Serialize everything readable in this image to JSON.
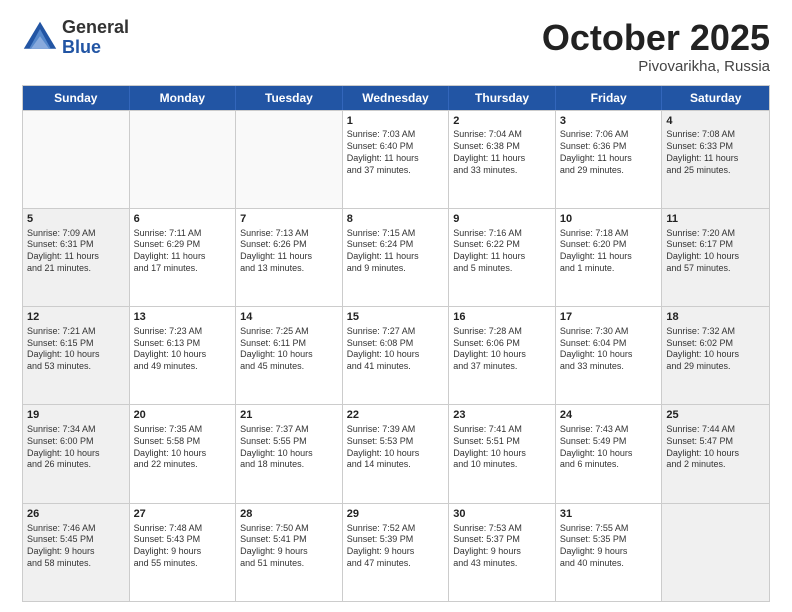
{
  "header": {
    "logo": {
      "general": "General",
      "blue": "Blue"
    },
    "title": "October 2025",
    "subtitle": "Pivovarikha, Russia"
  },
  "calendar": {
    "days": [
      "Sunday",
      "Monday",
      "Tuesday",
      "Wednesday",
      "Thursday",
      "Friday",
      "Saturday"
    ],
    "rows": [
      [
        {
          "day": "",
          "info": "",
          "empty": true
        },
        {
          "day": "",
          "info": "",
          "empty": true
        },
        {
          "day": "",
          "info": "",
          "empty": true
        },
        {
          "day": "1",
          "info": "Sunrise: 7:03 AM\nSunset: 6:40 PM\nDaylight: 11 hours\nand 37 minutes."
        },
        {
          "day": "2",
          "info": "Sunrise: 7:04 AM\nSunset: 6:38 PM\nDaylight: 11 hours\nand 33 minutes."
        },
        {
          "day": "3",
          "info": "Sunrise: 7:06 AM\nSunset: 6:36 PM\nDaylight: 11 hours\nand 29 minutes."
        },
        {
          "day": "4",
          "info": "Sunrise: 7:08 AM\nSunset: 6:33 PM\nDaylight: 11 hours\nand 25 minutes.",
          "shaded": true
        }
      ],
      [
        {
          "day": "5",
          "info": "Sunrise: 7:09 AM\nSunset: 6:31 PM\nDaylight: 11 hours\nand 21 minutes.",
          "shaded": true
        },
        {
          "day": "6",
          "info": "Sunrise: 7:11 AM\nSunset: 6:29 PM\nDaylight: 11 hours\nand 17 minutes."
        },
        {
          "day": "7",
          "info": "Sunrise: 7:13 AM\nSunset: 6:26 PM\nDaylight: 11 hours\nand 13 minutes."
        },
        {
          "day": "8",
          "info": "Sunrise: 7:15 AM\nSunset: 6:24 PM\nDaylight: 11 hours\nand 9 minutes."
        },
        {
          "day": "9",
          "info": "Sunrise: 7:16 AM\nSunset: 6:22 PM\nDaylight: 11 hours\nand 5 minutes."
        },
        {
          "day": "10",
          "info": "Sunrise: 7:18 AM\nSunset: 6:20 PM\nDaylight: 11 hours\nand 1 minute."
        },
        {
          "day": "11",
          "info": "Sunrise: 7:20 AM\nSunset: 6:17 PM\nDaylight: 10 hours\nand 57 minutes.",
          "shaded": true
        }
      ],
      [
        {
          "day": "12",
          "info": "Sunrise: 7:21 AM\nSunset: 6:15 PM\nDaylight: 10 hours\nand 53 minutes.",
          "shaded": true
        },
        {
          "day": "13",
          "info": "Sunrise: 7:23 AM\nSunset: 6:13 PM\nDaylight: 10 hours\nand 49 minutes."
        },
        {
          "day": "14",
          "info": "Sunrise: 7:25 AM\nSunset: 6:11 PM\nDaylight: 10 hours\nand 45 minutes."
        },
        {
          "day": "15",
          "info": "Sunrise: 7:27 AM\nSunset: 6:08 PM\nDaylight: 10 hours\nand 41 minutes."
        },
        {
          "day": "16",
          "info": "Sunrise: 7:28 AM\nSunset: 6:06 PM\nDaylight: 10 hours\nand 37 minutes."
        },
        {
          "day": "17",
          "info": "Sunrise: 7:30 AM\nSunset: 6:04 PM\nDaylight: 10 hours\nand 33 minutes."
        },
        {
          "day": "18",
          "info": "Sunrise: 7:32 AM\nSunset: 6:02 PM\nDaylight: 10 hours\nand 29 minutes.",
          "shaded": true
        }
      ],
      [
        {
          "day": "19",
          "info": "Sunrise: 7:34 AM\nSunset: 6:00 PM\nDaylight: 10 hours\nand 26 minutes.",
          "shaded": true
        },
        {
          "day": "20",
          "info": "Sunrise: 7:35 AM\nSunset: 5:58 PM\nDaylight: 10 hours\nand 22 minutes."
        },
        {
          "day": "21",
          "info": "Sunrise: 7:37 AM\nSunset: 5:55 PM\nDaylight: 10 hours\nand 18 minutes."
        },
        {
          "day": "22",
          "info": "Sunrise: 7:39 AM\nSunset: 5:53 PM\nDaylight: 10 hours\nand 14 minutes."
        },
        {
          "day": "23",
          "info": "Sunrise: 7:41 AM\nSunset: 5:51 PM\nDaylight: 10 hours\nand 10 minutes."
        },
        {
          "day": "24",
          "info": "Sunrise: 7:43 AM\nSunset: 5:49 PM\nDaylight: 10 hours\nand 6 minutes."
        },
        {
          "day": "25",
          "info": "Sunrise: 7:44 AM\nSunset: 5:47 PM\nDaylight: 10 hours\nand 2 minutes.",
          "shaded": true
        }
      ],
      [
        {
          "day": "26",
          "info": "Sunrise: 7:46 AM\nSunset: 5:45 PM\nDaylight: 9 hours\nand 58 minutes.",
          "shaded": true
        },
        {
          "day": "27",
          "info": "Sunrise: 7:48 AM\nSunset: 5:43 PM\nDaylight: 9 hours\nand 55 minutes."
        },
        {
          "day": "28",
          "info": "Sunrise: 7:50 AM\nSunset: 5:41 PM\nDaylight: 9 hours\nand 51 minutes."
        },
        {
          "day": "29",
          "info": "Sunrise: 7:52 AM\nSunset: 5:39 PM\nDaylight: 9 hours\nand 47 minutes."
        },
        {
          "day": "30",
          "info": "Sunrise: 7:53 AM\nSunset: 5:37 PM\nDaylight: 9 hours\nand 43 minutes."
        },
        {
          "day": "31",
          "info": "Sunrise: 7:55 AM\nSunset: 5:35 PM\nDaylight: 9 hours\nand 40 minutes."
        },
        {
          "day": "",
          "info": "",
          "empty": true,
          "shaded": true
        }
      ]
    ]
  }
}
